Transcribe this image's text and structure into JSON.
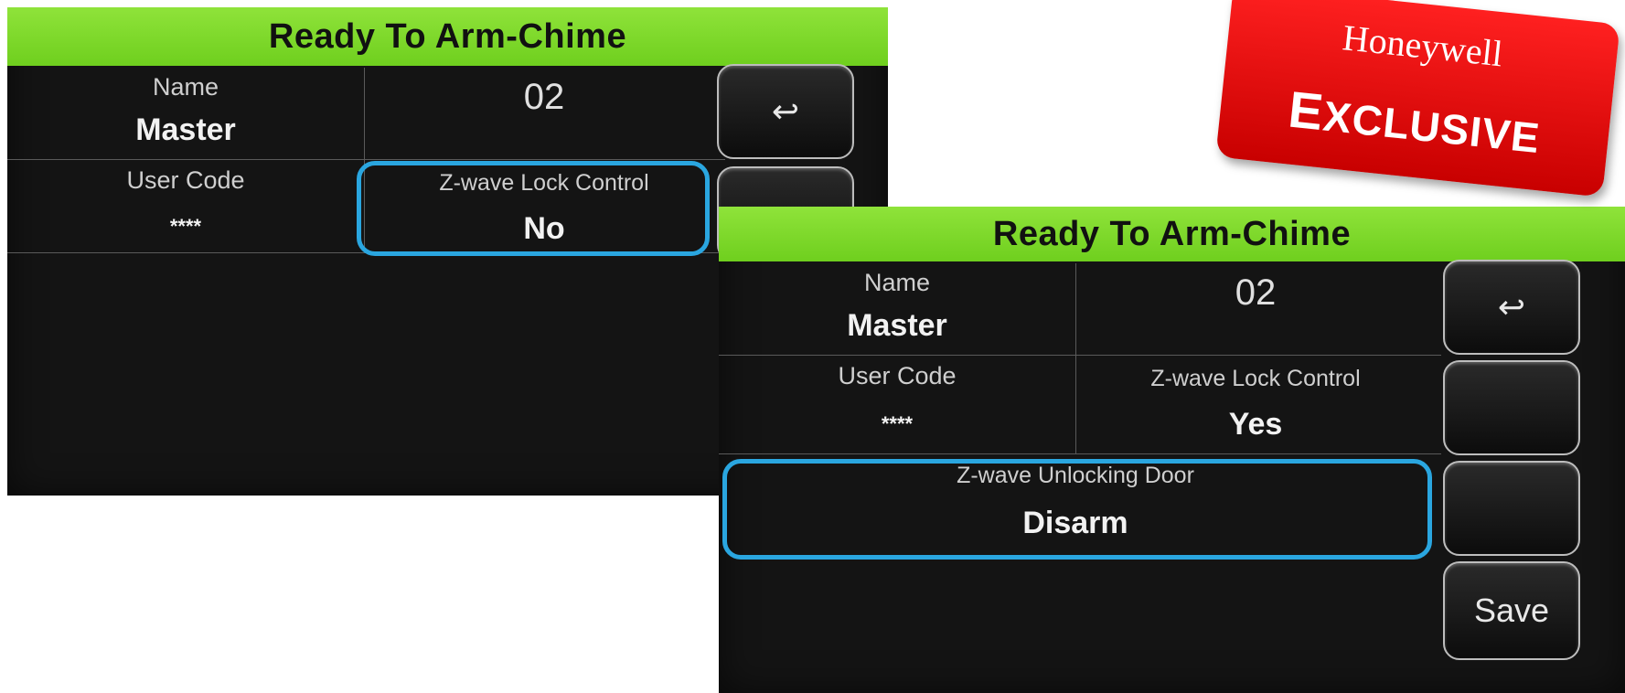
{
  "left_screen": {
    "status": "Ready To Arm-Chime",
    "name_label": "Name",
    "name_value": "Master",
    "user_number": "02",
    "user_code_label": "User Code",
    "user_code_value": "****",
    "lock_control_label": "Z-wave Lock Control",
    "lock_control_value": "No",
    "back_icon": "↩"
  },
  "right_screen": {
    "status": "Ready To Arm-Chime",
    "name_label": "Name",
    "name_value": "Master",
    "user_number": "02",
    "user_code_label": "User Code",
    "user_code_value": "****",
    "lock_control_label": "Z-wave Lock Control",
    "lock_control_value": "Yes",
    "unlocking_label": "Z-wave Unlocking Door",
    "unlocking_value": "Disarm",
    "back_icon": "↩",
    "save_label": "Save"
  },
  "badge": {
    "brand": "Honeywell",
    "text_first": "E",
    "text_rest": "XCLUSIVE"
  },
  "colors": {
    "header_green": "#7ed82a",
    "highlight_blue": "#2aa6e0",
    "badge_red": "#e00000"
  }
}
